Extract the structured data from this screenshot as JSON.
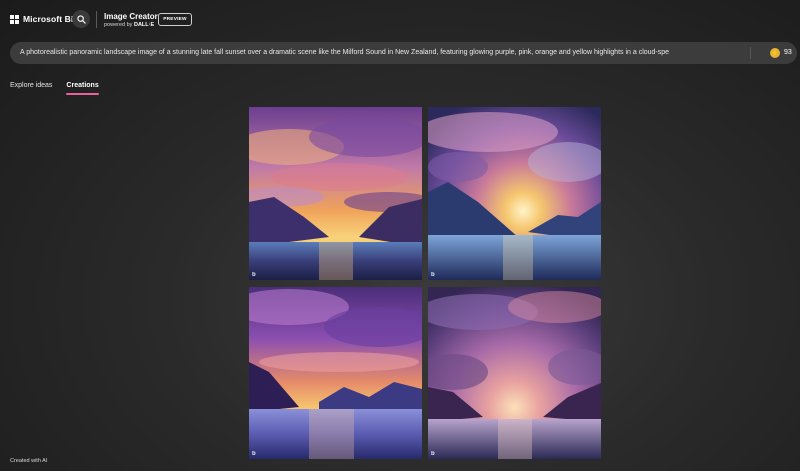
{
  "header": {
    "brand": "Microsoft Bing",
    "app_title": "Image Creator",
    "powered_by_prefix": "powered by",
    "powered_by_name": "DALL·E",
    "preview_badge": "PREVIEW"
  },
  "prompt": {
    "value": "A photorealistic panoramic landscape image of a stunning late fall sunset over a dramatic scene like the Milford Sound in New Zealand, featuring glowing purple, pink, orange and yellow highlights in a cloud-spe"
  },
  "boosts": {
    "count": "93"
  },
  "tabs": [
    {
      "label": "Explore ideas",
      "active": false
    },
    {
      "label": "Creations",
      "active": true
    }
  ],
  "images": [
    {
      "id": "image-1",
      "watermark": "b"
    },
    {
      "id": "image-2",
      "watermark": "b"
    },
    {
      "id": "image-3",
      "watermark": "b"
    },
    {
      "id": "image-4",
      "watermark": "b"
    }
  ],
  "footer": {
    "note": "Created with AI"
  },
  "colors": {
    "accent_underline": "#e8629a",
    "coin": "#e6b430",
    "prompt_bar": "#3c3c3c"
  }
}
